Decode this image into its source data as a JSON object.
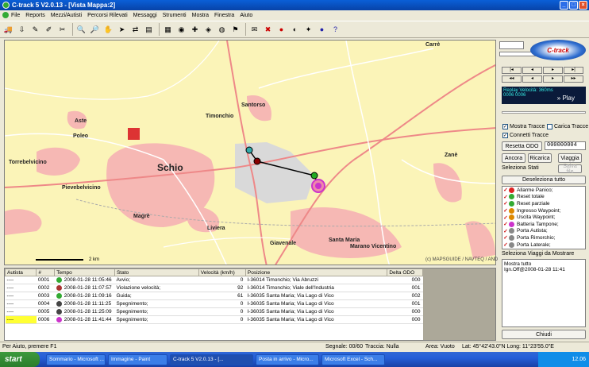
{
  "window": {
    "title": "C-track 5 V2.0.13 - [Vista Mappa:2]"
  },
  "menu": [
    "File",
    "Reports",
    "Mezzi/Autisti",
    "Percorsi Rilevati",
    "Messaggi",
    "Strumenti",
    "Mostra",
    "Finestra",
    "Aiuto"
  ],
  "map": {
    "places": [
      "Schio",
      "Santorso",
      "Timonchio",
      "Aste",
      "Poleo",
      "Torrebelvicino",
      "Pievebelvicino",
      "Magrè",
      "Liviera",
      "Giavenale",
      "Santa Maria",
      "Marano Vicentino",
      "Zanè",
      "Carrè"
    ],
    "scale": "2 km",
    "copyright": "(c) MAPSGUIDE / NAVTEQ / AND"
  },
  "right_panel": {
    "logo": "C-track",
    "replay_label": "Replay Velocità: 360ms",
    "replay_counter": "0006 0006",
    "play_label": "» Play",
    "mostra_tracce": "Mostra Tracce",
    "carica_tracce": "Carica Tracce",
    "connetti_tracce": "Connetti Tracce",
    "resetta_odo": "Resetta ODO",
    "odo_value": "000000004",
    "ancora": "Ancora",
    "ricarica": "Ricarica",
    "viaggia": "Viaggia",
    "salva": "Salva file",
    "seleziona_stati": "Seleziona Stati",
    "deseleziona": "Deseleziona tutto",
    "stati": [
      {
        "label": "Allarme Panico;",
        "color": "#d22"
      },
      {
        "label": "Reset totale",
        "color": "#3a3"
      },
      {
        "label": "Reset parziale",
        "color": "#3a3"
      },
      {
        "label": "Ingresso Waypoint;",
        "color": "#d80"
      },
      {
        "label": "Uscita Waypoint;",
        "color": "#d80"
      },
      {
        "label": "Batteria Tampone;",
        "color": "#c3c"
      },
      {
        "label": "Porta Autista;",
        "color": "#888"
      },
      {
        "label": "Porta Rimorchio;",
        "color": "#888"
      },
      {
        "label": "Porta Laterale;",
        "color": "#888"
      }
    ],
    "seleziona_viaggi": "Seleziona Viaggi da Mostrare",
    "viaggi_text_1": "Mostra tutto",
    "viaggi_text_2": "Ign.Off@2008-01-28 11:41",
    "chiudi": "Chiudi"
  },
  "grid": {
    "headers": [
      "Autista",
      "#",
      "Tempo",
      "Stato",
      "Velocità (km/h)",
      "Posizione",
      "Delta ODO"
    ],
    "rows": [
      {
        "autista": "----",
        "n": "0001",
        "tempo": "2008-01-28 11:05:46",
        "stato": "Avvio;",
        "vel": "0",
        "pos": "I-36014 Timonchio; Via Abruzzi",
        "odo": "000",
        "color": "#3a3"
      },
      {
        "autista": "----",
        "n": "0002",
        "tempo": "2008-01-28 11:07:57",
        "stato": "Violazione velocità;",
        "vel": "92",
        "pos": "I-36014 Timonchio; Viale dell'Industria",
        "odo": "001",
        "color": "#a33"
      },
      {
        "autista": "----",
        "n": "0003",
        "tempo": "2008-01-28 11:09:16",
        "stato": "Guida;",
        "vel": "61",
        "pos": "I-36035 Santa Maria; Via Lago di Vico",
        "odo": "002",
        "color": "#3a3"
      },
      {
        "autista": "----",
        "n": "0004",
        "tempo": "2008-01-28 11:11:25",
        "stato": "Spegnimento;",
        "vel": "0",
        "pos": "I-36035 Santa Maria; Via Lago di Vico",
        "odo": "001",
        "color": "#444"
      },
      {
        "autista": "----",
        "n": "0005",
        "tempo": "2008-01-28 11:25:09",
        "stato": "Spegnimento;",
        "vel": "0",
        "pos": "I-36035 Santa Maria; Via Lago di Vico",
        "odo": "000",
        "color": "#444"
      },
      {
        "autista": "----",
        "n": "0006",
        "tempo": "2008-01-28 11:41:44",
        "stato": "Spegnimento;",
        "vel": "0",
        "pos": "I-36035 Santa Maria; Via Lago di Vico",
        "odo": "000",
        "color": "#c3c"
      }
    ]
  },
  "statusbar": {
    "help": "Per Aiuto, premere F1",
    "segnale": "Segnale: 00/60",
    "traccia": "Traccia: Nulla",
    "area": "Area: Vuoto",
    "latlong": "Lat: 45°42'43.0\"N Long: 11°23'55.0\"E"
  },
  "taskbar": {
    "start": "start",
    "items": [
      "Sommario - Microsoft ...",
      "Immagine - Paint",
      "C-track 5 V2.0.13 - [...",
      "Posta in arrivo - Micro...",
      "Microsoft Excel - Sch..."
    ],
    "clock": "12.06"
  }
}
